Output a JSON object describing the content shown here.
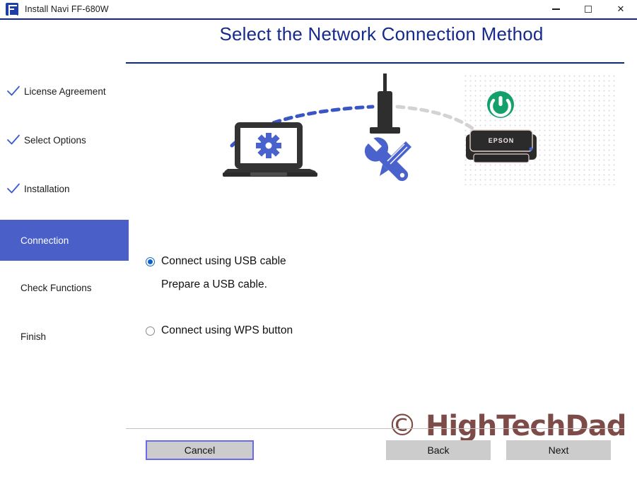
{
  "window": {
    "title": "Install Navi FF-680W",
    "icon": "epson-app-icon",
    "controls": [
      {
        "name": "minimize",
        "glyph": "minimize-icon"
      },
      {
        "name": "maximize",
        "glyph": "maximize-icon"
      },
      {
        "name": "close",
        "glyph": "close-icon",
        "label": "✕"
      }
    ]
  },
  "header": {
    "title": "Select the Network Connection Method"
  },
  "sidebar": {
    "items": [
      {
        "label": "License Agreement",
        "state": "done"
      },
      {
        "label": "Select Options",
        "state": "done"
      },
      {
        "label": "Installation",
        "state": "done"
      },
      {
        "label": "Connection",
        "state": "current"
      },
      {
        "label": "Check Functions",
        "state": "todo"
      },
      {
        "label": "Finish",
        "state": "todo"
      }
    ],
    "highlight_color": "#4a5fc8",
    "check_color": "#3a5bd0"
  },
  "illustration": {
    "laptop_icon": "laptop-with-gear-icon",
    "router_icon": "wireless-router-icon",
    "tools_icon": "wrench-screwdriver-icon",
    "printer_icon": "epson-printer-icon",
    "power_icon": "power-button-icon",
    "printer_brand": "EPSON",
    "accent_blue": "#4a63cc",
    "device_dark": "#333333",
    "power_green": "#16a06a"
  },
  "options": {
    "items": [
      {
        "label": "Connect using USB cable",
        "selected": true,
        "sub": "Prepare a USB cable."
      },
      {
        "label": "Connect using WPS button",
        "selected": false,
        "sub": ""
      }
    ]
  },
  "watermark": {
    "symbol": "©",
    "text": "HighTechDad",
    "color": "#7d4c48"
  },
  "footer": {
    "cancel_label": "Cancel",
    "back_label": "Back",
    "next_label": "Next"
  }
}
